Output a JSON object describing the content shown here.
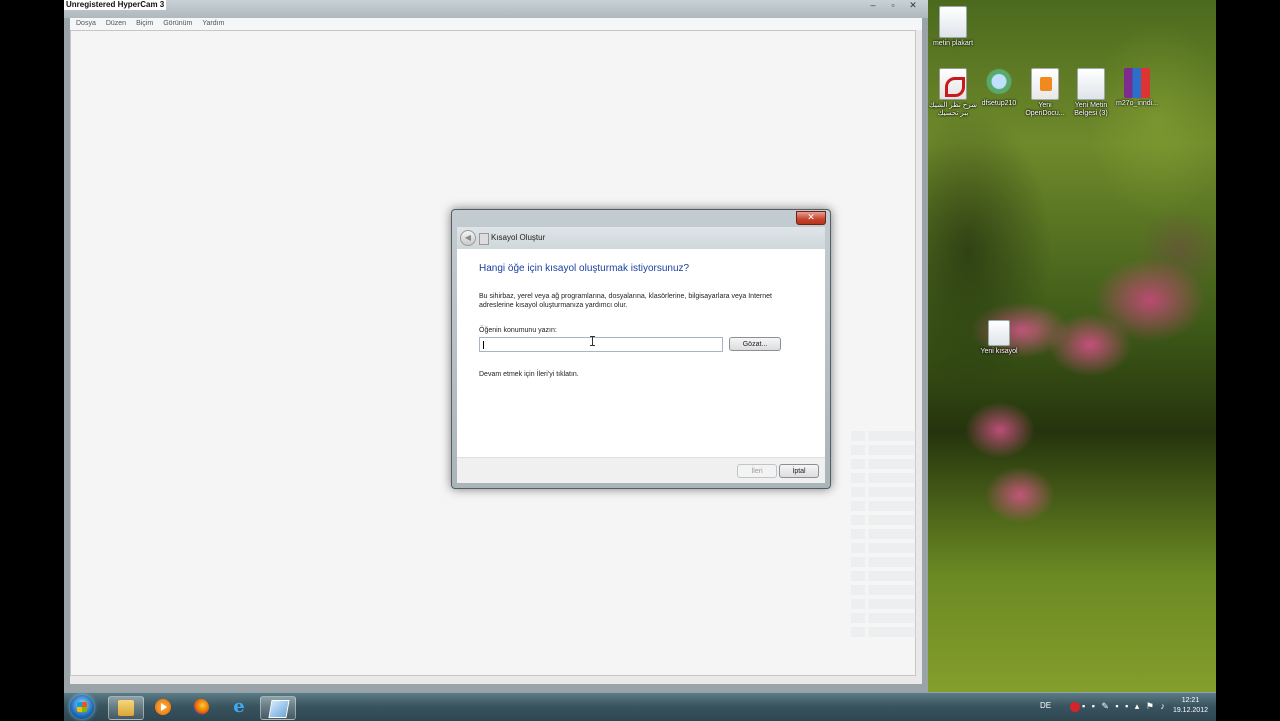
{
  "recorder": {
    "label": "Unregistered HyperCam 3"
  },
  "main_window": {
    "menu": [
      "Dosya",
      "Düzen",
      "Biçim",
      "Görünüm",
      "Yardım"
    ],
    "controls": [
      "‒",
      "▫",
      "✕"
    ]
  },
  "dialog": {
    "title": "Kısayol Oluştur",
    "heading": "Hangi öğe için kısayol oluşturmak istiyorsunuz?",
    "description": "Bu sihirbaz, yerel veya ağ programlarına, dosyalarına, klasörlerine, bilgisayarlara veya Internet adreslerine kısayol oluşturmanıza yardımcı olur.",
    "location_label": "Öğenin konumunu yazın:",
    "location_value": "",
    "browse_label": "Gözat...",
    "hint": "Devam etmek için İleri'yi tıklatın.",
    "next_label": "İleri",
    "cancel_label": "İptal",
    "close_glyph": "✕",
    "back_glyph": "◀"
  },
  "desktop": {
    "icons": [
      {
        "label": "metin plakart",
        "icon": "document-icon"
      },
      {
        "label": "شرح نظر الشيك ببر تحسيك",
        "icon": "pdf-icon"
      },
      {
        "label": "dfsetup210",
        "icon": "installer-icon"
      },
      {
        "label": "Yeni OpenDocu...",
        "icon": "opendocument-icon"
      },
      {
        "label": "Yeni Metin Belgesi (3)",
        "icon": "text-document-icon"
      },
      {
        "label": "m27o_inndi...",
        "icon": "archive-icon"
      },
      {
        "label": "Yeni kısayol",
        "icon": "shortcut-icon"
      }
    ]
  },
  "taskbar": {
    "pinned": [
      "folder-icon",
      "media-player-icon",
      "firefox-icon",
      "ie-icon",
      "window-icon"
    ],
    "language": "DE",
    "time": "12:21",
    "date": "19.12.2012"
  }
}
